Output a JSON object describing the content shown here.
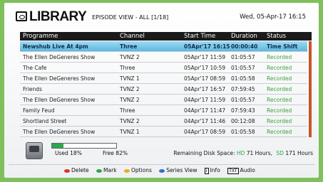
{
  "header": {
    "title": "LIBRARY",
    "subtitle": "EPISODE VIEW - ALL  [1/18]",
    "datetime": "Wed, 05-Apr-17 16:15",
    "library_icon": "tv-library-icon"
  },
  "table": {
    "columns": [
      "Programme",
      "Channel",
      "Start Time",
      "Duration",
      "Status"
    ],
    "selected_index": 0,
    "rows": [
      {
        "programme": "Newshub Live At 4pm",
        "channel": "Three",
        "start": "05Apr'17 16:15",
        "duration": "00:00:40",
        "status": "Time Shift"
      },
      {
        "programme": "The Ellen DeGeneres Show",
        "channel": "TVNZ 2",
        "start": "05Apr'17 11:59",
        "duration": "01:05:57",
        "status": "Recorded"
      },
      {
        "programme": "The Cafe",
        "channel": "Three",
        "start": "05Apr'17 10:59",
        "duration": "01:05:57",
        "status": "Recorded"
      },
      {
        "programme": "The Ellen DeGeneres Show",
        "channel": "TVNZ 1",
        "start": "05Apr'17 08:59",
        "duration": "01:05:58",
        "status": "Recorded"
      },
      {
        "programme": "Friends",
        "channel": "TVNZ 2",
        "start": "04Apr'17 16:57",
        "duration": "07:59:45",
        "status": "Recorded"
      },
      {
        "programme": "The Ellen DeGeneres Show",
        "channel": "TVNZ 2",
        "start": "04Apr'17 11:59",
        "duration": "01:05:57",
        "status": "Recorded"
      },
      {
        "programme": "Family Feud",
        "channel": "Three",
        "start": "04Apr'17 11:47",
        "duration": "07:59:43",
        "status": "Recorded"
      },
      {
        "programme": "Shortland Street",
        "channel": "TVNZ 2",
        "start": "04Apr'17 11:46",
        "duration": "00:12:08",
        "status": "Recorded"
      },
      {
        "programme": "The Ellen DeGeneres Show",
        "channel": "TVNZ 1",
        "start": "04Apr'17 08:59",
        "duration": "01:05:58",
        "status": "Recorded"
      }
    ]
  },
  "disk": {
    "icon": "hard-disk-icon",
    "used_label": "Used 18%",
    "free_label": "Free 82%",
    "used_fraction": 0.18,
    "bar_color": "#2aa84a",
    "remaining_label": "Remaining Disk Space:",
    "hd_label": "HD",
    "hd_value": "71 Hours,",
    "sd_label": "SD",
    "sd_value": "171 Hours"
  },
  "footer": {
    "delete": {
      "label": "Delete",
      "color": "#d8332b",
      "icon": "red-button-icon"
    },
    "mark": {
      "label": "Mark",
      "color": "#2aa84a",
      "icon": "green-button-icon"
    },
    "options": {
      "label": "Options",
      "color": "#e0b21c",
      "icon": "yellow-button-icon"
    },
    "series_view": {
      "label": "Series View",
      "color": "#2e6fd1",
      "icon": "blue-button-icon"
    },
    "info": {
      "key": "i",
      "label": "Info",
      "icon": "info-key-icon"
    },
    "audio": {
      "key": "TXT",
      "label": "Audio",
      "icon": "text-key-icon"
    }
  },
  "colors": {
    "selected_row": "#5cb8e0",
    "recorded_status": "#3aa33a",
    "scroll_thumb": "#c4562a",
    "background": "#7fbf5c"
  }
}
